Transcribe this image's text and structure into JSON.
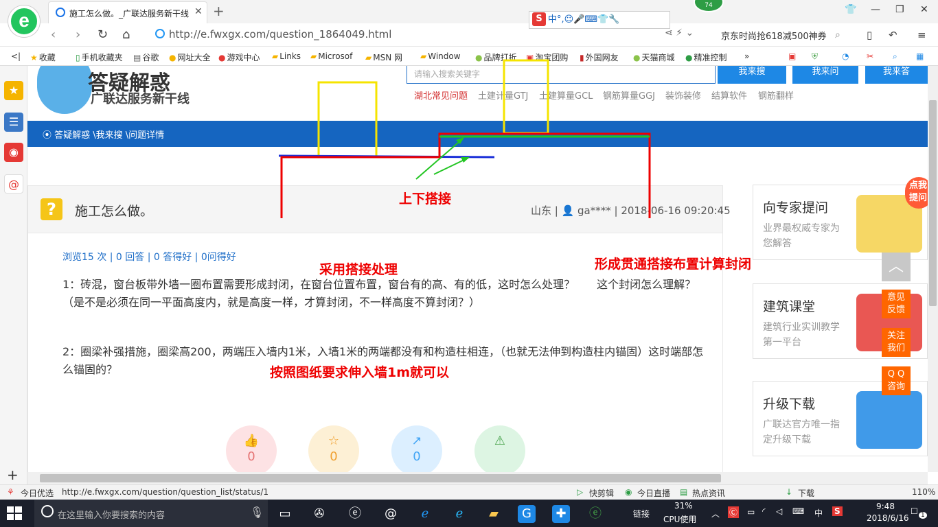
{
  "browser": {
    "tab_title": "施工怎么做。_广联达服务新干线",
    "tab_close": "✕",
    "new_tab": "+",
    "badge": "74",
    "ime_label": "中°,☺🎤⌨👕🔧",
    "url": "http://e.fwxgx.com/question_1864049.html",
    "search_ad": "京东时尚抢618减500神券",
    "favorites": [
      {
        "icon": "★",
        "label": "收藏"
      },
      {
        "icon": "▯",
        "label": "手机收藏夹"
      },
      {
        "icon": "▤",
        "label": "谷歌"
      },
      {
        "icon": "●",
        "label": "网址大全"
      },
      {
        "icon": "●",
        "label": "游戏中心"
      },
      {
        "icon": "▰",
        "label": "Links"
      },
      {
        "icon": "▰",
        "label": "Microsof"
      },
      {
        "icon": "▰",
        "label": "MSN 网"
      },
      {
        "icon": "▰",
        "label": "Window"
      },
      {
        "icon": "●",
        "label": "品牌打折"
      },
      {
        "icon": "▣",
        "label": "淘宝团购"
      },
      {
        "icon": "▮",
        "label": "外国网友"
      },
      {
        "icon": "●",
        "label": "天猫商城"
      },
      {
        "icon": "●",
        "label": "精准控制"
      }
    ]
  },
  "site": {
    "header_title": "答疑解惑",
    "header_subtitle": "广联达服务新干线",
    "search_placeholder": "请输入搜索关键字",
    "btn_search": "我来搜",
    "btn_ask": "我来问",
    "btn_answer": "我来答",
    "hot_links": [
      "湖北常见问题",
      "土建计量GTJ",
      "土建算量GCL",
      "钢筋算量GGJ",
      "装饰装修",
      "结算软件",
      "钢筋翻样"
    ],
    "breadcrumb": "答疑解惑 \\我来搜 \\问题详情"
  },
  "question": {
    "title": "施工怎么做。",
    "meta": "山东 | 👤 ga**** | 2018-06-16 09:20:45",
    "stats": "浏览15 次 | 0 回答 | 0 答得好 | 0问得好",
    "para1": "1：砖混，窗台板带外墙一圈布置需要形成封闭，在窗台位置布置，窗台有的高、有的低，这时怎么处理？　　这个封闭怎么理解？（是不是必须在同一平面高度内，就是高度一样，才算封闭，不一样高度不算封闭？）",
    "para2": "2：圈梁补强措施，圈梁高200，两端压入墙内1米，入墙1米的两端都没有和构造柱相连，（也就无法伸到构造柱内锚固）这时端部怎么锚固的？",
    "actions": [
      {
        "icon": "👍",
        "count": "0",
        "color": "#fde2e4",
        "fg": "#e57373"
      },
      {
        "icon": "☆",
        "count": "0",
        "color": "#fdf0d5",
        "fg": "#f0a030"
      },
      {
        "icon": "↗",
        "count": "0",
        "color": "#dcefff",
        "fg": "#42a5f5"
      },
      {
        "icon": "⚠",
        "count": "",
        "color": "#ddf5e3",
        "fg": "#43a047"
      }
    ]
  },
  "annotations": {
    "overlap": "上下搭接",
    "use_overlap": "采用搭接处理",
    "through": "形成贯通搭接布置计算封闭",
    "anchor": "按照图纸要求伸入墙1m就可以"
  },
  "right_cards": [
    {
      "title": "向专家提问",
      "desc": "业界最权威专家为您解答",
      "color": "#f5d04a"
    },
    {
      "title": "建筑课堂",
      "desc": "建筑行业实训教学第一平台",
      "color": "#e53935"
    },
    {
      "title": "升级下载",
      "desc": "广联达官方唯一指定升级下载",
      "color": "#1e88e5"
    }
  ],
  "float_buttons": [
    "意见反馈",
    "关注我们",
    "Q Q咨询"
  ],
  "mascot_bubble": "点我提问",
  "statusbar": {
    "left": "今日优选",
    "url": "http://e.fwxgx.com/question/question_list/status/1",
    "items": [
      "快剪辑",
      "今日直播",
      "热点资讯",
      "下载",
      "110%"
    ]
  },
  "taskbar": {
    "search_placeholder": "在这里输入你要搜索的内容",
    "link": "链接",
    "cpu": "31%",
    "cpu_label": "CPU使用",
    "ime": "中",
    "time": "9:48",
    "date": "2018/6/16",
    "notif": "1"
  }
}
